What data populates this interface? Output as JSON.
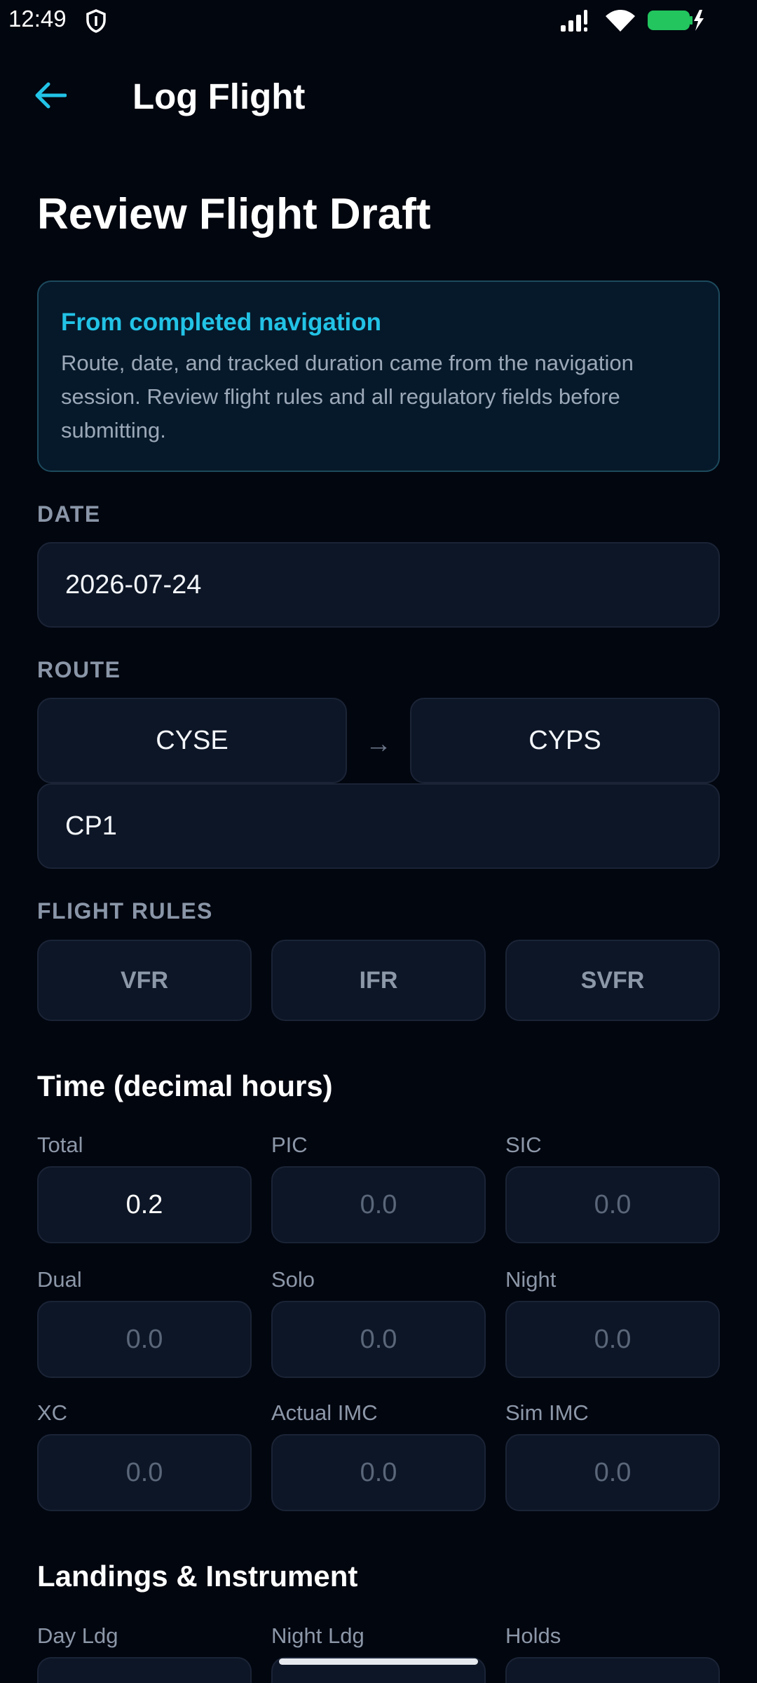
{
  "status_bar": {
    "time": "12:49",
    "icons": [
      "shield-icon",
      "signal-icon",
      "wifi-icon",
      "battery-charging-icon"
    ],
    "battery_color": "#22c55e"
  },
  "app_bar": {
    "title": "Log Flight",
    "back_icon": "arrow-left-icon",
    "accent_color": "#22c3e6"
  },
  "page": {
    "title": "Review Flight Draft"
  },
  "info_card": {
    "title": "From completed navigation",
    "body": "Route, date, and tracked duration came from the navigation session. Review flight rules and all regulatory fields before submitting."
  },
  "date": {
    "label": "DATE",
    "value": "2026-07-24"
  },
  "route": {
    "label": "ROUTE",
    "from": "CYSE",
    "arrow": "→",
    "to": "CYPS",
    "via": "CP1"
  },
  "flight_rules": {
    "label": "FLIGHT RULES",
    "options": [
      "VFR",
      "IFR",
      "SVFR"
    ]
  },
  "time": {
    "heading": "Time (decimal hours)",
    "fields": [
      {
        "label": "Total",
        "value": "0.2",
        "filled": true
      },
      {
        "label": "PIC",
        "value": "0.0",
        "filled": false
      },
      {
        "label": "SIC",
        "value": "0.0",
        "filled": false
      },
      {
        "label": "Dual",
        "value": "0.0",
        "filled": false
      },
      {
        "label": "Solo",
        "value": "0.0",
        "filled": false
      },
      {
        "label": "Night",
        "value": "0.0",
        "filled": false
      },
      {
        "label": "XC",
        "value": "0.0",
        "filled": false
      },
      {
        "label": "Actual IMC",
        "value": "0.0",
        "filled": false
      },
      {
        "label": "Sim IMC",
        "value": "0.0",
        "filled": false
      }
    ]
  },
  "landings": {
    "heading": "Landings & Instrument",
    "labels": [
      "Day Ldg",
      "Night Ldg",
      "Holds"
    ]
  }
}
